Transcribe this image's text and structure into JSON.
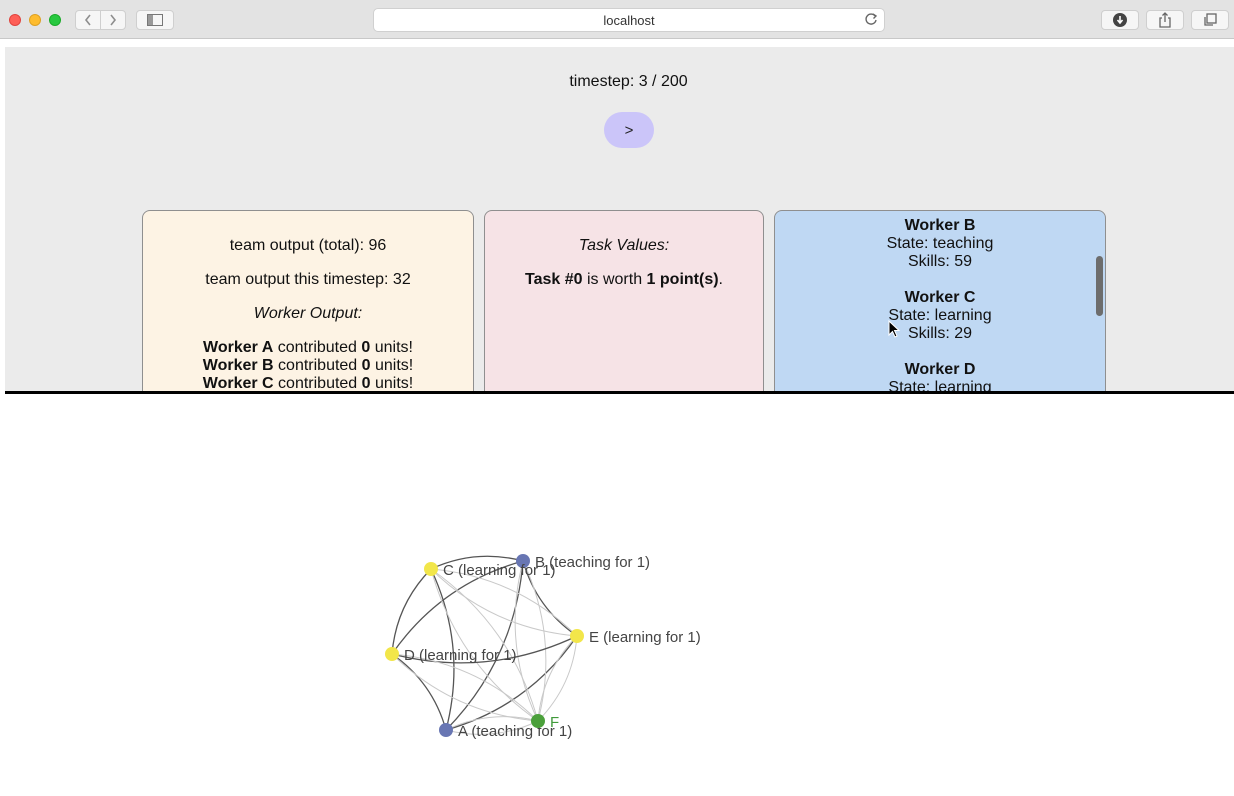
{
  "browser": {
    "url": "localhost",
    "back_icon": "chevron-left-icon",
    "forward_icon": "chevron-right-icon",
    "sidebar_icon": "sidebar-icon",
    "reload_icon": "reload-icon",
    "download_icon": "download-icon",
    "share_icon": "share-icon",
    "tabs_icon": "tabs-icon"
  },
  "sim": {
    "timestep_label": "timestep: 3 / 200",
    "next_button": ">"
  },
  "output_panel": {
    "team_total": "team output (total): 96",
    "team_this": "team output this timestep: 32",
    "worker_output_heading": "Worker Output:",
    "workers": [
      {
        "name": "Worker A",
        "mid": " contributed ",
        "units": "0",
        "tail": " units!"
      },
      {
        "name": "Worker B",
        "mid": " contributed ",
        "units": "0",
        "tail": " units!"
      },
      {
        "name": "Worker C",
        "mid": " contributed ",
        "units": "0",
        "tail": " units!"
      }
    ]
  },
  "task_panel": {
    "heading": "Task Values:",
    "task_name": "Task #0",
    "mid": " is worth ",
    "points": "1 point(s)",
    "tail": "."
  },
  "workers_panel": {
    "workers": [
      {
        "name": "Worker B",
        "state": "State: teaching",
        "skills": "Skills: 59"
      },
      {
        "name": "Worker C",
        "state": "State: learning",
        "skills": "Skills: 29"
      },
      {
        "name": "Worker D",
        "state": "State: learning",
        "skills": ""
      }
    ]
  },
  "graph": {
    "colors": {
      "teaching": "#6876b3",
      "learning": "#f2e64a",
      "other": "#4ba03b",
      "edge_strong": "#555555",
      "edge_weak": "#c9c9c9",
      "label": "#444444",
      "label_other": "#3f9a3a"
    },
    "nodes": [
      {
        "id": "A",
        "label": "A (teaching for 1)",
        "kind": "teaching"
      },
      {
        "id": "B",
        "label": "B (teaching for 1)",
        "kind": "teaching"
      },
      {
        "id": "C",
        "label": "C (learning for 1)",
        "kind": "learning"
      },
      {
        "id": "D",
        "label": "D (learning for 1)",
        "kind": "learning"
      },
      {
        "id": "E",
        "label": "E (learning for 1)",
        "kind": "learning"
      },
      {
        "id": "F",
        "label": "F",
        "kind": "other"
      }
    ]
  }
}
